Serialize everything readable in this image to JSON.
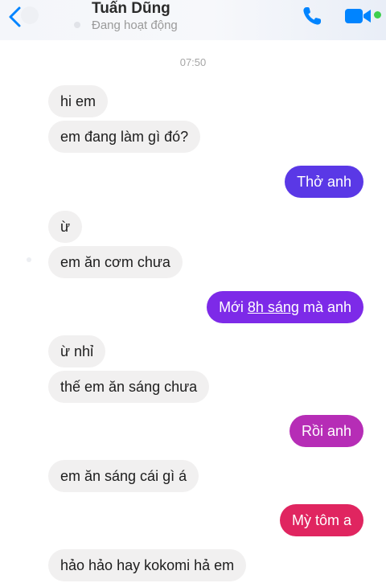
{
  "header": {
    "contact_name": "Tuấn Dũng",
    "status_text": "Đang hoạt động",
    "back_icon": "chevron-left-icon",
    "call_icon": "phone-icon",
    "video_icon": "video-camera-icon",
    "accent": "#0084ff",
    "online_color": "#3ecf4e"
  },
  "conversation": {
    "timestamp": "07:50",
    "messages": [
      {
        "side": "incoming",
        "text": "hi em"
      },
      {
        "side": "incoming",
        "text": "em đang làm gì đó?"
      },
      {
        "side": "outgoing",
        "text": "Thở anh",
        "color": "#5a38e6"
      },
      {
        "side": "incoming",
        "text": "ừ"
      },
      {
        "side": "incoming",
        "text": "em ăn cơm chưa"
      },
      {
        "side": "outgoing",
        "text_before": "Mới ",
        "text_link": "8h sáng",
        "text_after": " mà anh",
        "color": "#7d2ae8"
      },
      {
        "side": "incoming",
        "text": "ừ nhỉ"
      },
      {
        "side": "incoming",
        "text": "thế em ăn sáng chưa"
      },
      {
        "side": "outgoing",
        "text": "Rồi anh",
        "color": "#b62db6"
      },
      {
        "side": "incoming",
        "text": "em ăn sáng cái gì á"
      },
      {
        "side": "outgoing",
        "text": "Mỳ tôm a",
        "color": "#e02560"
      },
      {
        "side": "incoming",
        "text": "hảo hảo hay kokomi hả em"
      }
    ]
  }
}
